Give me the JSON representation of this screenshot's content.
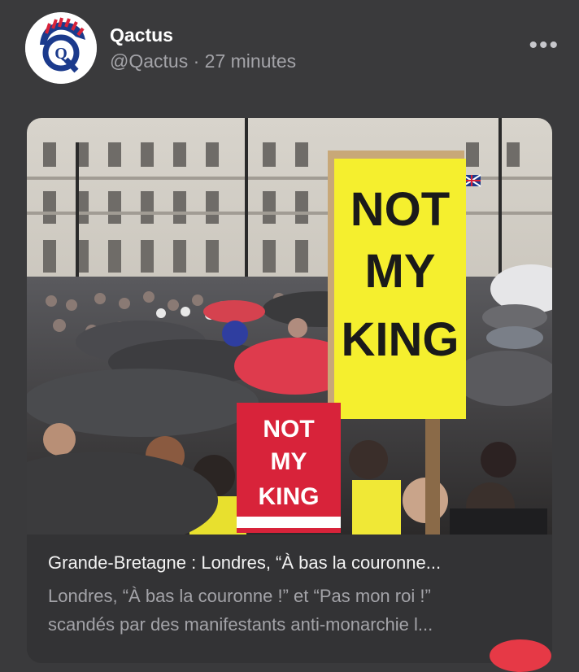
{
  "post": {
    "author_name": "Qactus",
    "handle": "@Qactus",
    "separator": "·",
    "time_ago": "27 minutes",
    "more_label": "•••"
  },
  "card": {
    "title": "Grande-Bretagne : Londres, “À bas la couronne...",
    "description_line1": "Londres, “À bas la couronne !” et “Pas mon roi !”",
    "description_line2": "scandés par des manifestants anti-monarchie l..."
  },
  "photo": {
    "sign_large_lines": [
      "NOT",
      "MY",
      "KING"
    ],
    "sign_small_lines": [
      "NOT",
      "MY",
      "KING"
    ]
  },
  "avatar_letter": "Q",
  "colors": {
    "background": "#3a3a3c",
    "sign_yellow": "#f5ef2e",
    "sign_red": "#d8233a",
    "badge_red": "#e63946"
  }
}
